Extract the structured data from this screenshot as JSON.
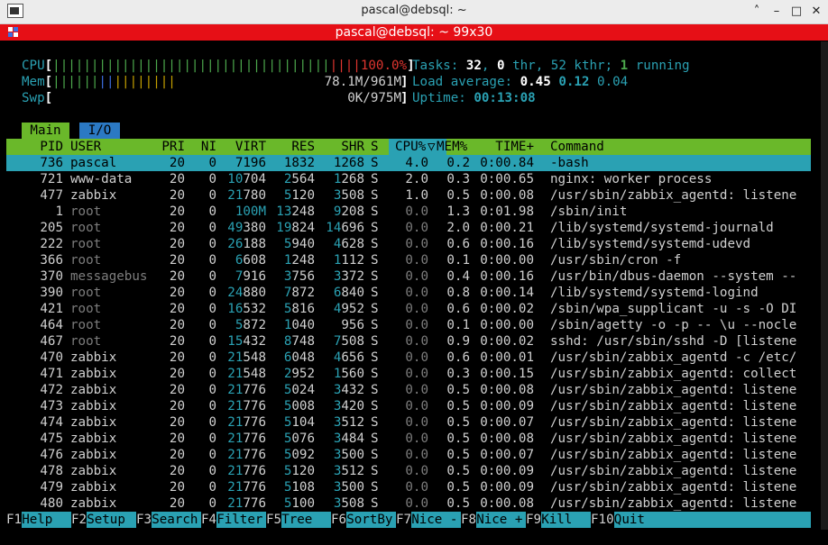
{
  "window": {
    "title": "pascal@debsql: ~",
    "buttons": {
      "collapse": "˄",
      "minimize": "–",
      "maximize": "□",
      "close": "✕"
    }
  },
  "tab": {
    "title": "pascal@debsql: ~ 99x30"
  },
  "meters": {
    "cpu_label": "CPU",
    "cpu_bar_green": "||||||||||||||||||||||||||||||||||||",
    "cpu_bar_red": "||||",
    "cpu_value": "100.0%",
    "cpu_level": 1.0,
    "mem_label": "Mem",
    "mem_bar_green": "||||||",
    "mem_bar_blue": "||",
    "mem_bar_yellow": "||||||||",
    "mem_value": "78.1M/961M",
    "swp_label": "Swp",
    "swp_value": "0K/975M"
  },
  "summary": {
    "tasks_label": "Tasks: ",
    "tasks_count": "32",
    "tasks_sep": ", ",
    "thr_count": "0",
    "thr_label": " thr, ",
    "kthr": "52 kthr; ",
    "running_count": "1",
    "running_label": " running",
    "load_label": "Load average: ",
    "load1": "0.45",
    "load5": "0.12",
    "load15": "0.04",
    "uptime_label": "Uptime: ",
    "uptime": "00:13:08"
  },
  "view_tabs": [
    {
      "label": "Main",
      "active": true
    },
    {
      "label": "I/O",
      "active": false
    }
  ],
  "columns": [
    "PID",
    "USER",
    "PRI",
    "NI",
    "VIRT",
    "RES",
    "SHR",
    "S",
    "CPU%",
    "▽",
    "MEM%",
    "TIME+",
    "Command"
  ],
  "processes": [
    {
      "pid": "736",
      "user": "pascal",
      "pri": "20",
      "ni": "0",
      "virt": "7196",
      "res": "1832",
      "shr": "1268",
      "s": "S",
      "cpu": "4.0",
      "mem": "0.2",
      "time": "0:00.84",
      "cmd": "-bash"
    },
    {
      "pid": "721",
      "user": "www-data",
      "pri": "20",
      "ni": "0",
      "virt": "10704",
      "res": "2564",
      "shr": "1268",
      "s": "S",
      "cpu": "2.0",
      "mem": "0.3",
      "time": "0:00.65",
      "cmd": "nginx: worker process"
    },
    {
      "pid": "477",
      "user": "zabbix",
      "pri": "20",
      "ni": "0",
      "virt": "21780",
      "res": "5120",
      "shr": "3508",
      "s": "S",
      "cpu": "1.0",
      "mem": "0.5",
      "time": "0:00.08",
      "cmd": "/usr/sbin/zabbix_agentd: listene"
    },
    {
      "pid": "1",
      "user": "root",
      "pri": "20",
      "ni": "0",
      "virt": "100M",
      "res": "13248",
      "shr": "9208",
      "s": "S",
      "cpu": "0.0",
      "mem": "1.3",
      "time": "0:01.98",
      "cmd": "/sbin/init"
    },
    {
      "pid": "205",
      "user": "root",
      "pri": "20",
      "ni": "0",
      "virt": "49380",
      "res": "19824",
      "shr": "14696",
      "s": "S",
      "cpu": "0.0",
      "mem": "2.0",
      "time": "0:00.21",
      "cmd": "/lib/systemd/systemd-journald"
    },
    {
      "pid": "222",
      "user": "root",
      "pri": "20",
      "ni": "0",
      "virt": "26188",
      "res": "5940",
      "shr": "4628",
      "s": "S",
      "cpu": "0.0",
      "mem": "0.6",
      "time": "0:00.16",
      "cmd": "/lib/systemd/systemd-udevd"
    },
    {
      "pid": "366",
      "user": "root",
      "pri": "20",
      "ni": "0",
      "virt": "6608",
      "res": "1248",
      "shr": "1112",
      "s": "S",
      "cpu": "0.0",
      "mem": "0.1",
      "time": "0:00.00",
      "cmd": "/usr/sbin/cron -f"
    },
    {
      "pid": "370",
      "user": "messagebus",
      "pri": "20",
      "ni": "0",
      "virt": "7916",
      "res": "3756",
      "shr": "3372",
      "s": "S",
      "cpu": "0.0",
      "mem": "0.4",
      "time": "0:00.16",
      "cmd": "/usr/bin/dbus-daemon --system --"
    },
    {
      "pid": "390",
      "user": "root",
      "pri": "20",
      "ni": "0",
      "virt": "24880",
      "res": "7872",
      "shr": "6840",
      "s": "S",
      "cpu": "0.0",
      "mem": "0.8",
      "time": "0:00.14",
      "cmd": "/lib/systemd/systemd-logind"
    },
    {
      "pid": "421",
      "user": "root",
      "pri": "20",
      "ni": "0",
      "virt": "16532",
      "res": "5816",
      "shr": "4952",
      "s": "S",
      "cpu": "0.0",
      "mem": "0.6",
      "time": "0:00.02",
      "cmd": "/sbin/wpa_supplicant -u -s -O DI"
    },
    {
      "pid": "464",
      "user": "root",
      "pri": "20",
      "ni": "0",
      "virt": "5872",
      "res": "1040",
      "shr": "956",
      "s": "S",
      "cpu": "0.0",
      "mem": "0.1",
      "time": "0:00.00",
      "cmd": "/sbin/agetty -o -p -- \\u --nocle"
    },
    {
      "pid": "467",
      "user": "root",
      "pri": "20",
      "ni": "0",
      "virt": "15432",
      "res": "8748",
      "shr": "7508",
      "s": "S",
      "cpu": "0.0",
      "mem": "0.9",
      "time": "0:00.02",
      "cmd": "sshd: /usr/sbin/sshd -D [listene"
    },
    {
      "pid": "470",
      "user": "zabbix",
      "pri": "20",
      "ni": "0",
      "virt": "21548",
      "res": "6048",
      "shr": "4656",
      "s": "S",
      "cpu": "0.0",
      "mem": "0.6",
      "time": "0:00.01",
      "cmd": "/usr/sbin/zabbix_agentd -c /etc/"
    },
    {
      "pid": "471",
      "user": "zabbix",
      "pri": "20",
      "ni": "0",
      "virt": "21548",
      "res": "2952",
      "shr": "1560",
      "s": "S",
      "cpu": "0.0",
      "mem": "0.3",
      "time": "0:00.15",
      "cmd": "/usr/sbin/zabbix_agentd: collect"
    },
    {
      "pid": "472",
      "user": "zabbix",
      "pri": "20",
      "ni": "0",
      "virt": "21776",
      "res": "5024",
      "shr": "3432",
      "s": "S",
      "cpu": "0.0",
      "mem": "0.5",
      "time": "0:00.08",
      "cmd": "/usr/sbin/zabbix_agentd: listene"
    },
    {
      "pid": "473",
      "user": "zabbix",
      "pri": "20",
      "ni": "0",
      "virt": "21776",
      "res": "5008",
      "shr": "3420",
      "s": "S",
      "cpu": "0.0",
      "mem": "0.5",
      "time": "0:00.09",
      "cmd": "/usr/sbin/zabbix_agentd: listene"
    },
    {
      "pid": "474",
      "user": "zabbix",
      "pri": "20",
      "ni": "0",
      "virt": "21776",
      "res": "5104",
      "shr": "3512",
      "s": "S",
      "cpu": "0.0",
      "mem": "0.5",
      "time": "0:00.07",
      "cmd": "/usr/sbin/zabbix_agentd: listene"
    },
    {
      "pid": "475",
      "user": "zabbix",
      "pri": "20",
      "ni": "0",
      "virt": "21776",
      "res": "5076",
      "shr": "3484",
      "s": "S",
      "cpu": "0.0",
      "mem": "0.5",
      "time": "0:00.08",
      "cmd": "/usr/sbin/zabbix_agentd: listene"
    },
    {
      "pid": "476",
      "user": "zabbix",
      "pri": "20",
      "ni": "0",
      "virt": "21776",
      "res": "5092",
      "shr": "3500",
      "s": "S",
      "cpu": "0.0",
      "mem": "0.5",
      "time": "0:00.07",
      "cmd": "/usr/sbin/zabbix_agentd: listene"
    },
    {
      "pid": "478",
      "user": "zabbix",
      "pri": "20",
      "ni": "0",
      "virt": "21776",
      "res": "5120",
      "shr": "3512",
      "s": "S",
      "cpu": "0.0",
      "mem": "0.5",
      "time": "0:00.09",
      "cmd": "/usr/sbin/zabbix_agentd: listene"
    },
    {
      "pid": "479",
      "user": "zabbix",
      "pri": "20",
      "ni": "0",
      "virt": "21776",
      "res": "5108",
      "shr": "3500",
      "s": "S",
      "cpu": "0.0",
      "mem": "0.5",
      "time": "0:00.09",
      "cmd": "/usr/sbin/zabbix_agentd: listene"
    },
    {
      "pid": "480",
      "user": "zabbix",
      "pri": "20",
      "ni": "0",
      "virt": "21776",
      "res": "5100",
      "shr": "3508",
      "s": "S",
      "cpu": "0.0",
      "mem": "0.5",
      "time": "0:00.08",
      "cmd": "/usr/sbin/zabbix_agentd: listene"
    }
  ],
  "function_keys": [
    {
      "key": "F1",
      "label": "Help  "
    },
    {
      "key": "F2",
      "label": "Setup "
    },
    {
      "key": "F3",
      "label": "Search"
    },
    {
      "key": "F4",
      "label": "Filter"
    },
    {
      "key": "F5",
      "label": "Tree  "
    },
    {
      "key": "F6",
      "label": "SortBy"
    },
    {
      "key": "F7",
      "label": "Nice -"
    },
    {
      "key": "F8",
      "label": "Nice +"
    },
    {
      "key": "F9",
      "label": "Kill  "
    },
    {
      "key": "F10",
      "label": "Quit"
    }
  ]
}
